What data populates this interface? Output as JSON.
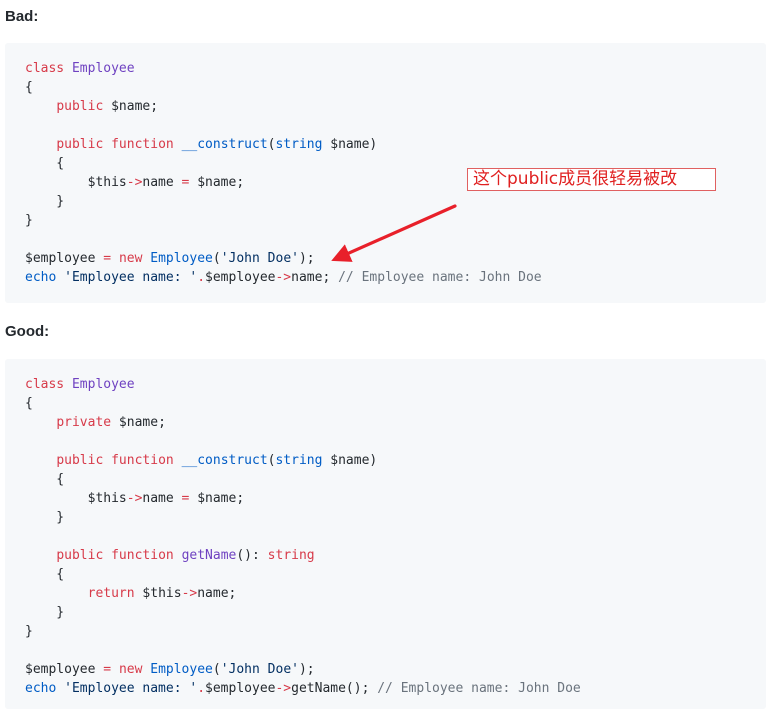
{
  "bad": {
    "heading": "Bad:",
    "lines": [
      [
        {
          "t": "class",
          "c": "kw"
        },
        {
          "t": " "
        },
        {
          "t": "Employee",
          "c": "cls"
        }
      ],
      [
        {
          "t": "{"
        }
      ],
      [
        {
          "t": "    "
        },
        {
          "t": "public",
          "c": "kw"
        },
        {
          "t": " $name;"
        }
      ],
      [],
      [
        {
          "t": "    "
        },
        {
          "t": "public",
          "c": "kw"
        },
        {
          "t": " "
        },
        {
          "t": "function",
          "c": "kw"
        },
        {
          "t": " "
        },
        {
          "t": "__construct",
          "c": "fn"
        },
        {
          "t": "("
        },
        {
          "t": "string",
          "c": "typ"
        },
        {
          "t": " $name)"
        }
      ],
      [
        {
          "t": "    {"
        }
      ],
      [
        {
          "t": "        $this"
        },
        {
          "t": "->",
          "c": "op"
        },
        {
          "t": "name "
        },
        {
          "t": "=",
          "c": "op"
        },
        {
          "t": " $name;"
        }
      ],
      [
        {
          "t": "    }"
        }
      ],
      [
        {
          "t": "}"
        }
      ],
      [],
      [
        {
          "t": "$employee "
        },
        {
          "t": "=",
          "c": "op"
        },
        {
          "t": " "
        },
        {
          "t": "new",
          "c": "kw"
        },
        {
          "t": " "
        },
        {
          "t": "Employee",
          "c": "fn"
        },
        {
          "t": "("
        },
        {
          "t": "'John Doe'",
          "c": "str"
        },
        {
          "t": ");"
        }
      ],
      [
        {
          "t": "echo",
          "c": "fn"
        },
        {
          "t": " "
        },
        {
          "t": "'Employee name: '",
          "c": "str"
        },
        {
          "t": ".",
          "c": "op"
        },
        {
          "t": "$employee"
        },
        {
          "t": "->",
          "c": "op"
        },
        {
          "t": "name; "
        },
        {
          "t": "// Employee name: John Doe",
          "c": "cmt"
        }
      ]
    ]
  },
  "good": {
    "heading": "Good:",
    "lines": [
      [
        {
          "t": "class",
          "c": "kw"
        },
        {
          "t": " "
        },
        {
          "t": "Employee",
          "c": "cls"
        }
      ],
      [
        {
          "t": "{"
        }
      ],
      [
        {
          "t": "    "
        },
        {
          "t": "private",
          "c": "kw"
        },
        {
          "t": " $name;"
        }
      ],
      [],
      [
        {
          "t": "    "
        },
        {
          "t": "public",
          "c": "kw"
        },
        {
          "t": " "
        },
        {
          "t": "function",
          "c": "kw"
        },
        {
          "t": " "
        },
        {
          "t": "__construct",
          "c": "fn"
        },
        {
          "t": "("
        },
        {
          "t": "string",
          "c": "typ"
        },
        {
          "t": " $name)"
        }
      ],
      [
        {
          "t": "    {"
        }
      ],
      [
        {
          "t": "        $this"
        },
        {
          "t": "->",
          "c": "op"
        },
        {
          "t": "name "
        },
        {
          "t": "=",
          "c": "op"
        },
        {
          "t": " $name;"
        }
      ],
      [
        {
          "t": "    }"
        }
      ],
      [],
      [
        {
          "t": "    "
        },
        {
          "t": "public",
          "c": "kw"
        },
        {
          "t": " "
        },
        {
          "t": "function",
          "c": "kw"
        },
        {
          "t": " "
        },
        {
          "t": "getName",
          "c": "cls"
        },
        {
          "t": "(): "
        },
        {
          "t": "string",
          "c": "kw"
        }
      ],
      [
        {
          "t": "    {"
        }
      ],
      [
        {
          "t": "        "
        },
        {
          "t": "return",
          "c": "kw"
        },
        {
          "t": " $this"
        },
        {
          "t": "->",
          "c": "op"
        },
        {
          "t": "name;"
        }
      ],
      [
        {
          "t": "    }"
        }
      ],
      [
        {
          "t": "}"
        }
      ],
      [],
      [
        {
          "t": "$employee "
        },
        {
          "t": "=",
          "c": "op"
        },
        {
          "t": " "
        },
        {
          "t": "new",
          "c": "kw"
        },
        {
          "t": " "
        },
        {
          "t": "Employee",
          "c": "fn"
        },
        {
          "t": "("
        },
        {
          "t": "'John Doe'",
          "c": "str"
        },
        {
          "t": ");"
        }
      ],
      [
        {
          "t": "echo",
          "c": "fn"
        },
        {
          "t": " "
        },
        {
          "t": "'Employee name: '",
          "c": "str"
        },
        {
          "t": ".",
          "c": "op"
        },
        {
          "t": "$employee"
        },
        {
          "t": "->",
          "c": "op"
        },
        {
          "t": "getName(); "
        },
        {
          "t": "// Employee name: John Doe",
          "c": "cmt"
        }
      ]
    ]
  },
  "annotation": {
    "text": "这个public成员很轻易被改",
    "color": "#e02020"
  },
  "colors": {
    "code_background": "#f6f8fa",
    "keyword": "#d73a49",
    "class_name": "#6f42c1",
    "function": "#005cc5",
    "string": "#032f62",
    "comment": "#6a737d",
    "arrow": "#e8202a"
  }
}
